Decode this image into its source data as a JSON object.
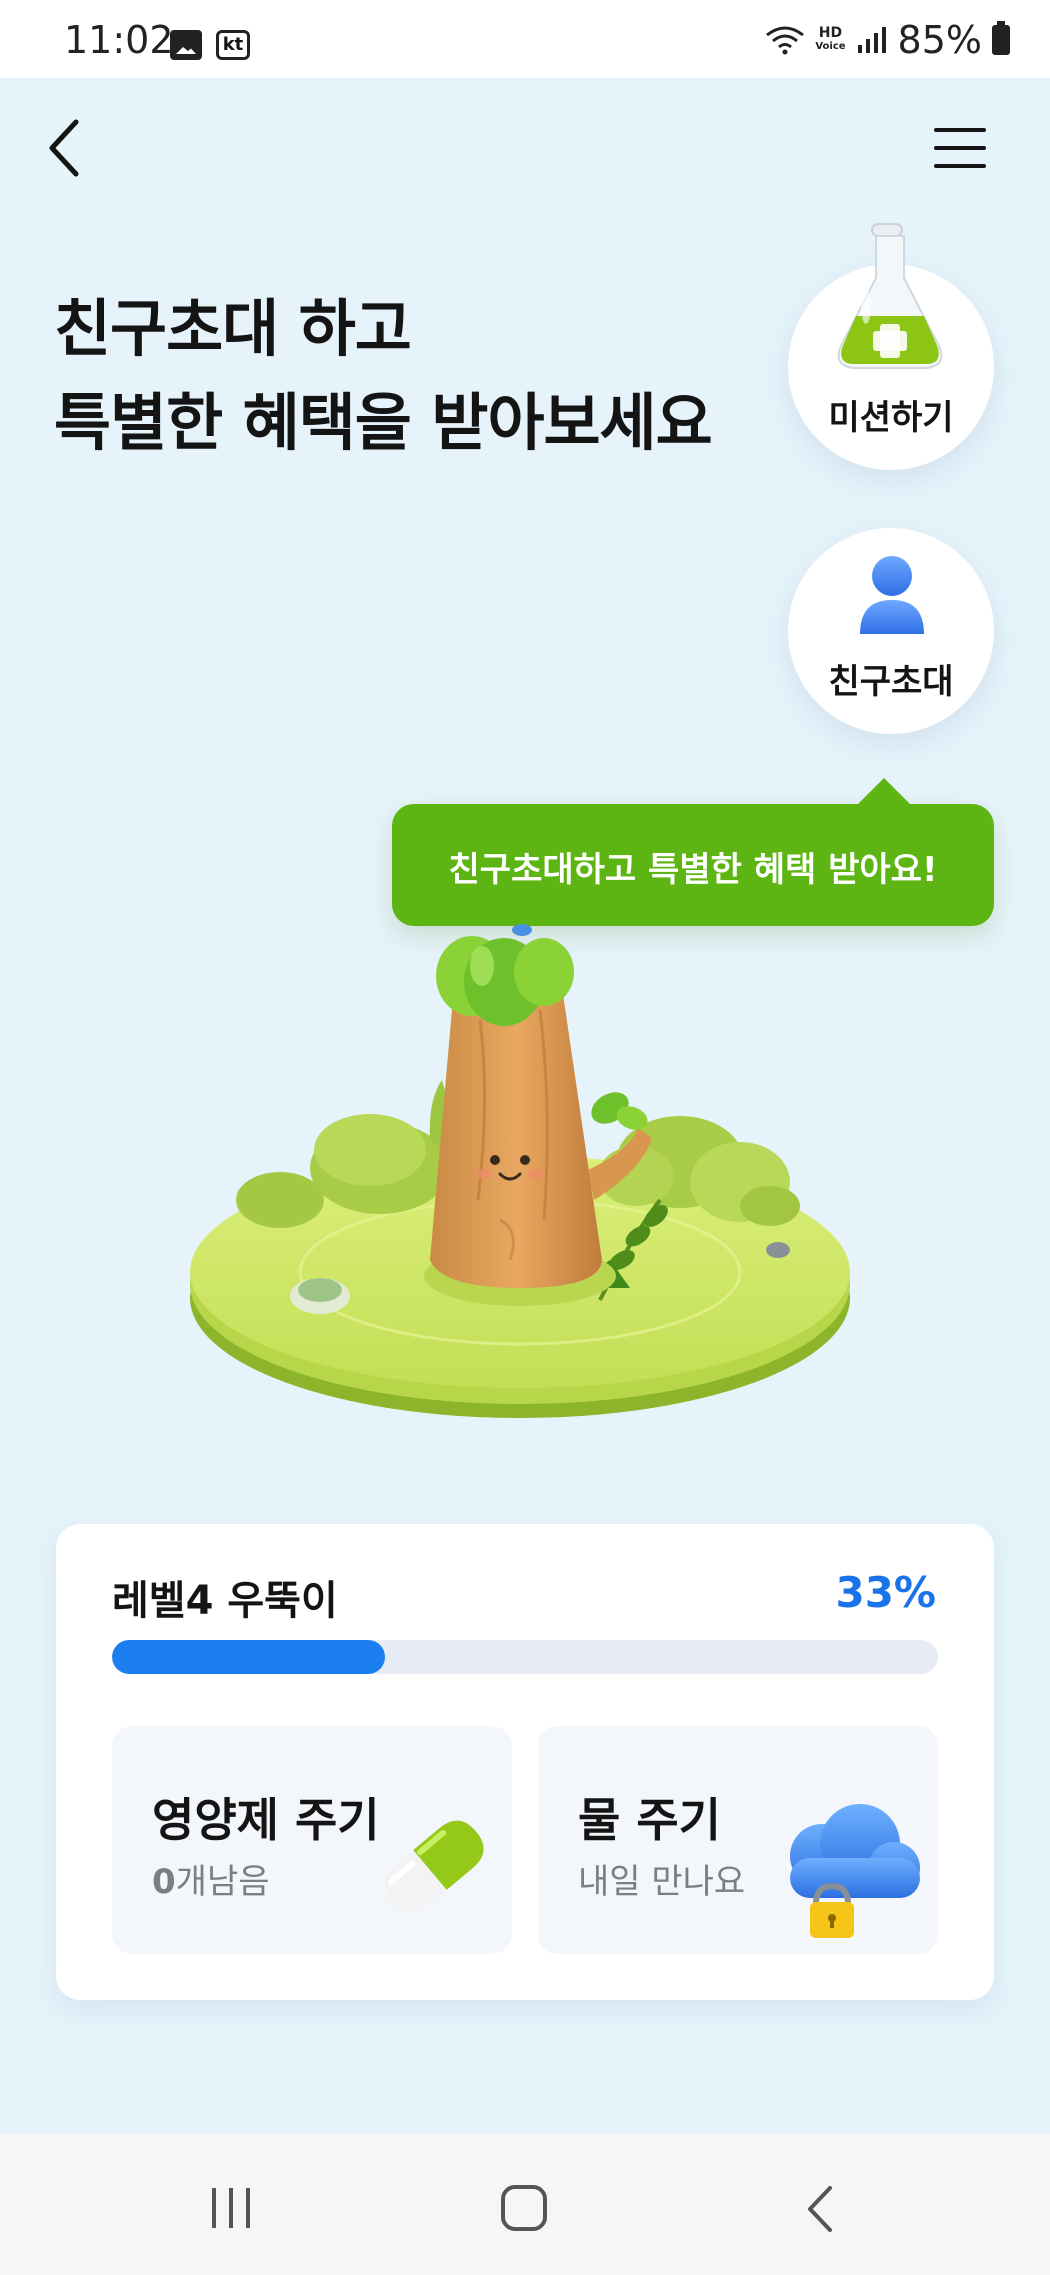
{
  "status_bar": {
    "time": "11:02",
    "left_icons": [
      "gallery-icon",
      "kt-icon"
    ],
    "hd_label_top": "HD",
    "hd_label_bottom": "Voice",
    "battery_text": "85%"
  },
  "nav": {
    "back_icon": "chevron-left-icon",
    "menu_icon": "hamburger-menu-icon"
  },
  "headline": {
    "line1": "친구초대 하고",
    "line2": "특별한 혜택을 받아보세요"
  },
  "side_buttons": {
    "mission": {
      "label": "미션하기",
      "icon": "flask-icon"
    },
    "invite": {
      "label": "친구초대",
      "icon": "person-icon"
    }
  },
  "tooltip": {
    "text": "친구초대하고 특별한 혜택 받아요!"
  },
  "level_card": {
    "level_title": "레벨4 우뚝이",
    "percent_text": "33%",
    "progress": 0.33,
    "nutrient": {
      "title": "영양제 주기",
      "count": "0",
      "sub_suffix": "개남음",
      "icon": "pill-icon"
    },
    "water": {
      "title": "물 주기",
      "sub": "내일 만나요",
      "icon": "cloud-lock-icon"
    }
  },
  "bottom_nav": {
    "icons": [
      "recent-apps-icon",
      "home-icon",
      "back-icon"
    ]
  },
  "colors": {
    "background": "#e6f3fb",
    "accent_green": "#5cb512",
    "accent_blue": "#1c7ff0",
    "percent_blue": "#1a73e8"
  }
}
